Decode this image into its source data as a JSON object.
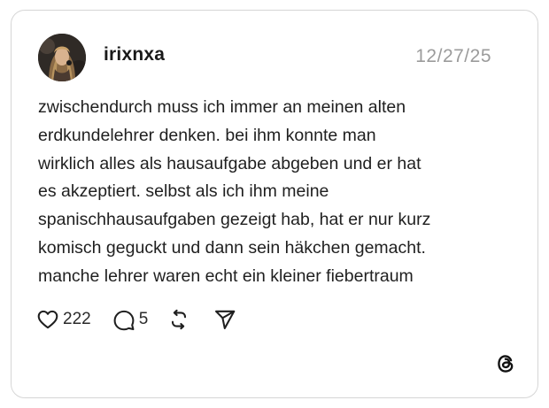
{
  "post": {
    "username": "irixnxa",
    "date": "12/27/25",
    "text_lines": [
      "zwischendurch muss ich immer an meinen alten",
      "erdkundelehrer denken. bei ihm konnte man",
      "wirklich alles als hausaufgabe abgeben und er hat",
      "es akzeptiert. selbst als ich ihm meine",
      "spanischhausaufgaben gezeigt hab, hat er nur kurz",
      "komisch geguckt und dann sein häkchen gemacht.",
      "manche lehrer waren echt ein kleiner fiebertraum"
    ],
    "likes": "222",
    "replies": "5"
  },
  "icons": {
    "like": "heart-icon",
    "reply": "speech-bubble-icon",
    "repost": "repost-icon",
    "share": "send-icon",
    "brand": "threads-logo-icon"
  },
  "colors": {
    "text": "#1f1f1f",
    "muted": "#9b9b9b",
    "border": "#d6d6d6"
  }
}
